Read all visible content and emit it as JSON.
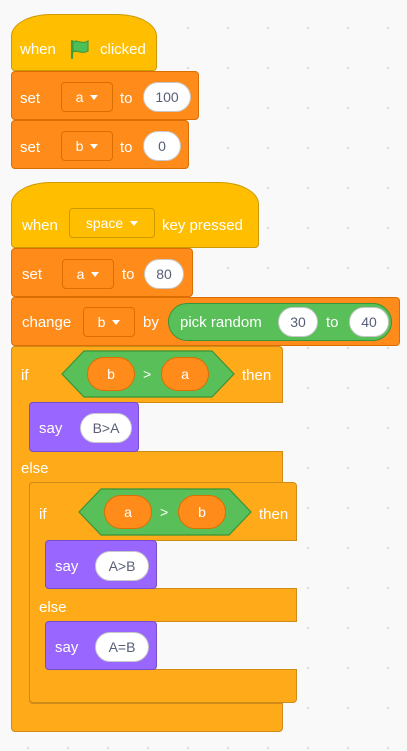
{
  "script1": {
    "when": "when",
    "clicked": "clicked",
    "set_a": {
      "label": "set",
      "var": "a",
      "to": "to",
      "value": "100"
    },
    "set_b": {
      "label": "set",
      "var": "b",
      "to": "to",
      "value": "0"
    }
  },
  "script2": {
    "when": "when",
    "key": "space",
    "key_pressed": "key pressed",
    "set_a": {
      "label": "set",
      "var": "a",
      "to": "to",
      "value": "80"
    },
    "change_b": {
      "label": "change",
      "var": "b",
      "by": "by",
      "pick_random": "pick random",
      "from": "30",
      "to": "to",
      "upto": "40"
    },
    "if1": {
      "if": "if",
      "left": "b",
      "op": ">",
      "right": "a",
      "then": "then",
      "say": {
        "label": "say",
        "text": "B>A"
      },
      "else": "else",
      "if2": {
        "if": "if",
        "left": "a",
        "op": ">",
        "right": "b",
        "then": "then",
        "say1": {
          "label": "say",
          "text": "A>B"
        },
        "else": "else",
        "say2": {
          "label": "say",
          "text": "A=B"
        }
      }
    }
  },
  "colors": {
    "events": "#FFBF00",
    "variables": "#FF8C1A",
    "control": "#FFAB19",
    "looks": "#9966FF",
    "operators": "#59C059",
    "flag": "#4CBF56"
  },
  "icons": {
    "green_flag": "green-flag-icon",
    "dropdown": "dropdown-arrow-icon"
  }
}
